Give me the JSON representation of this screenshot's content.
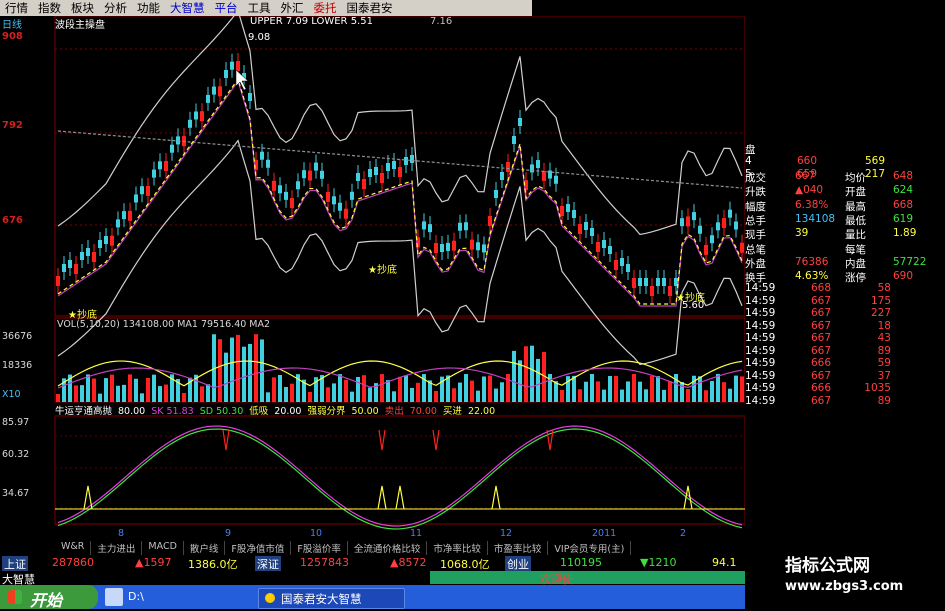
{
  "menu": [
    "行情",
    "指数",
    "板块",
    "分析",
    "功能",
    "大智慧",
    "平台",
    "工具",
    "外汇",
    "委托",
    "国泰君安"
  ],
  "chart": {
    "period_label": "日线",
    "indicator_name": "波段主操盘",
    "indicator_values": "UPPER 7.09  LOWER 5.51",
    "indicator_extra": "7.16",
    "price_high": "9.08",
    "price_low": "5.60",
    "y_labels": [
      "908",
      "792",
      "676"
    ],
    "signal_buy": "★抄底"
  },
  "volume": {
    "header": "VOL(5,10,20)  134108.00  MA1  79516.40  MA2",
    "y_labels": [
      "36676",
      "18336",
      "X10"
    ]
  },
  "oscillator": {
    "header_label": "牛运亨通高抛",
    "values": [
      {
        "label": "80.00",
        "color": "#ffffff"
      },
      {
        "label": "SK 51.83",
        "color": "#e040e0"
      },
      {
        "label": "SD 50.30",
        "color": "#40e040"
      },
      {
        "label": "低吸",
        "color": "#ffff40"
      },
      {
        "label": "20.00",
        "color": "#ffffff"
      },
      {
        "label": "强弱分界",
        "color": "#ffff40"
      },
      {
        "label": "50.00",
        "color": "#ffff40"
      },
      {
        "label": "卖出",
        "color": "#ff4040"
      },
      {
        "label": "70.00",
        "color": "#ff4040"
      },
      {
        "label": "买进",
        "color": "#ffff40"
      },
      {
        "label": "22.00",
        "color": "#ffff40"
      }
    ],
    "y_labels": [
      "85.97",
      "60.32",
      "34.67"
    ],
    "x_labels": [
      "8",
      "9",
      "10",
      "11",
      "12",
      "2011",
      "2"
    ]
  },
  "quote_panel": {
    "order_book": [
      {
        "label": "盘",
        "num": "",
        "price": "",
        "vol": ""
      },
      {
        "label": "",
        "num": "4",
        "price": "660",
        "vol": "569"
      },
      {
        "label": "",
        "num": "5",
        "price": "659",
        "vol": "217"
      }
    ],
    "stats": [
      {
        "k1": "成交",
        "v1": "667",
        "k2": "均价",
        "v2": "648",
        "c1": "#ff4040",
        "c2": "#ff4040"
      },
      {
        "k1": "升跌",
        "v1": "▲040",
        "k2": "开盘",
        "v2": "624",
        "c1": "#ff4040",
        "c2": "#40e040"
      },
      {
        "k1": "幅度",
        "v1": "6.38%",
        "k2": "最高",
        "v2": "668",
        "c1": "#ff4040",
        "c2": "#ff4040"
      },
      {
        "k1": "总手",
        "v1": "134108",
        "k2": "最低",
        "v2": "619",
        "c1": "#40c0ff",
        "c2": "#40e040"
      },
      {
        "k1": "现手",
        "v1": "39",
        "k2": "量比",
        "v2": "1.89",
        "c1": "#ffff40",
        "c2": "#ffff40"
      },
      {
        "k1": "总笔",
        "v1": "",
        "k2": "每笔",
        "v2": "",
        "c1": "#ffff40",
        "c2": "#ffff40"
      },
      {
        "k1": "外盘",
        "v1": "76386",
        "k2": "内盘",
        "v2": "57722",
        "c1": "#ff4040",
        "c2": "#40e040"
      },
      {
        "k1": "换手",
        "v1": "4.63%",
        "k2": "涨停",
        "v2": "690",
        "c1": "#ffff40",
        "c2": "#ff4040"
      }
    ],
    "ticks": [
      {
        "time": "14:59",
        "price": "668",
        "vol": "58"
      },
      {
        "time": "14:59",
        "price": "667",
        "vol": "175"
      },
      {
        "time": "14:59",
        "price": "667",
        "vol": "227"
      },
      {
        "time": "14:59",
        "price": "667",
        "vol": "18"
      },
      {
        "time": "14:59",
        "price": "667",
        "vol": "43"
      },
      {
        "time": "14:59",
        "price": "667",
        "vol": "89"
      },
      {
        "time": "14:59",
        "price": "666",
        "vol": "59"
      },
      {
        "time": "14:59",
        "price": "667",
        "vol": "37"
      },
      {
        "time": "14:59",
        "price": "666",
        "vol": "1035"
      },
      {
        "time": "14:59",
        "price": "667",
        "vol": "89"
      }
    ]
  },
  "bottom_tabs": [
    "W&R",
    "主力进出",
    "MACD",
    "散户线",
    "F股净值市值",
    "F股溢价率",
    "全流通价格比较",
    "市净率比较",
    "市盈率比较",
    "VIP会员专用(主)"
  ],
  "status": {
    "sh_label": "上证",
    "sh_value": "287860",
    "sh_change": "▲1597",
    "sh_amount": "1386.0亿",
    "sz_label": "深证",
    "sz_value": "1257843",
    "sz_change": "▲8572",
    "sz_amount": "1068.0亿",
    "cy_label": "创业",
    "cy_value": "110195",
    "cy_change": "▼1210",
    "cy_extra": "94.1"
  },
  "status2": {
    "brand": "大智慧",
    "welcome": "欢迎使"
  },
  "taskbar": {
    "start": "开始",
    "path": "D:\\",
    "window_title": "国泰君安大智慧"
  },
  "watermark": {
    "title": "指标公式网",
    "url": "www.zbgs3.com"
  }
}
